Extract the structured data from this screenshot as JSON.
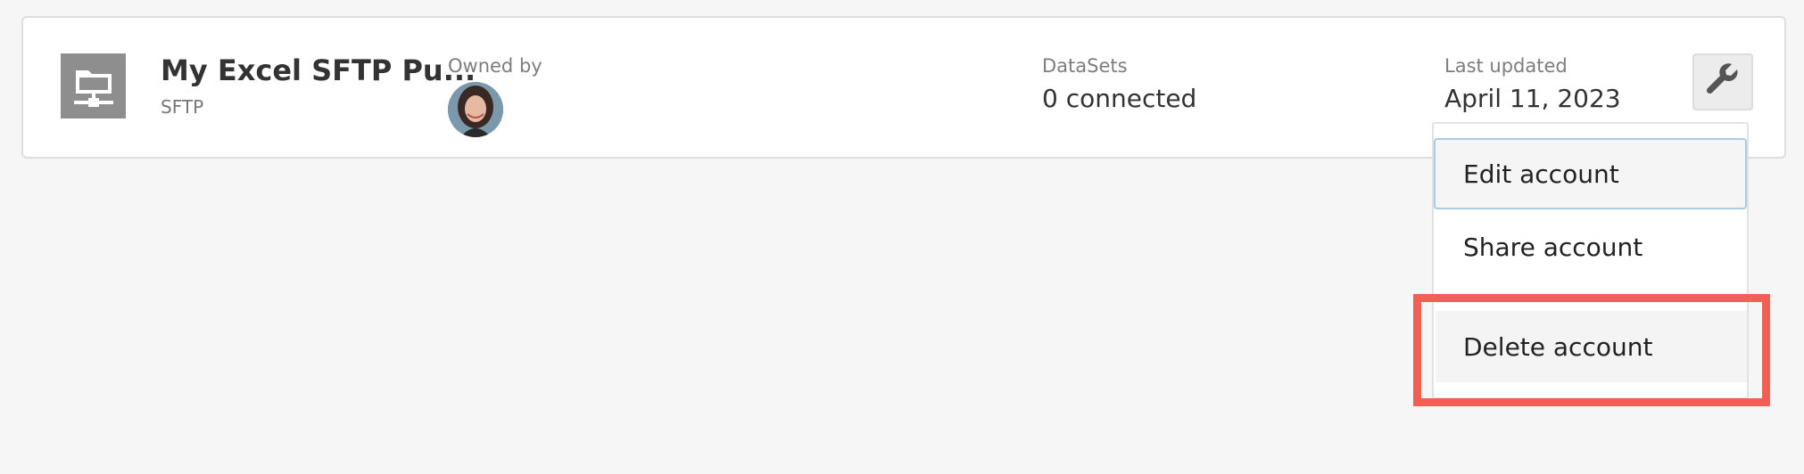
{
  "account": {
    "name": "My Excel SFTP Pu...",
    "type": "SFTP",
    "icon": "sftp-folder-network-icon"
  },
  "owner": {
    "label": "Owned by",
    "avatar": "user-avatar"
  },
  "datasets": {
    "label": "DataSets",
    "value": "0 connected"
  },
  "last_updated": {
    "label": "Last updated",
    "value": "April 11, 2023"
  },
  "actions": {
    "icon": "wrench-icon",
    "menu": {
      "edit_label": "Edit account",
      "share_label": "Share account",
      "delete_label": "Delete account"
    }
  },
  "colors": {
    "highlight": "#f26055",
    "focus_border": "#a9cbe6",
    "icon_bg": "#8e8e8e"
  }
}
